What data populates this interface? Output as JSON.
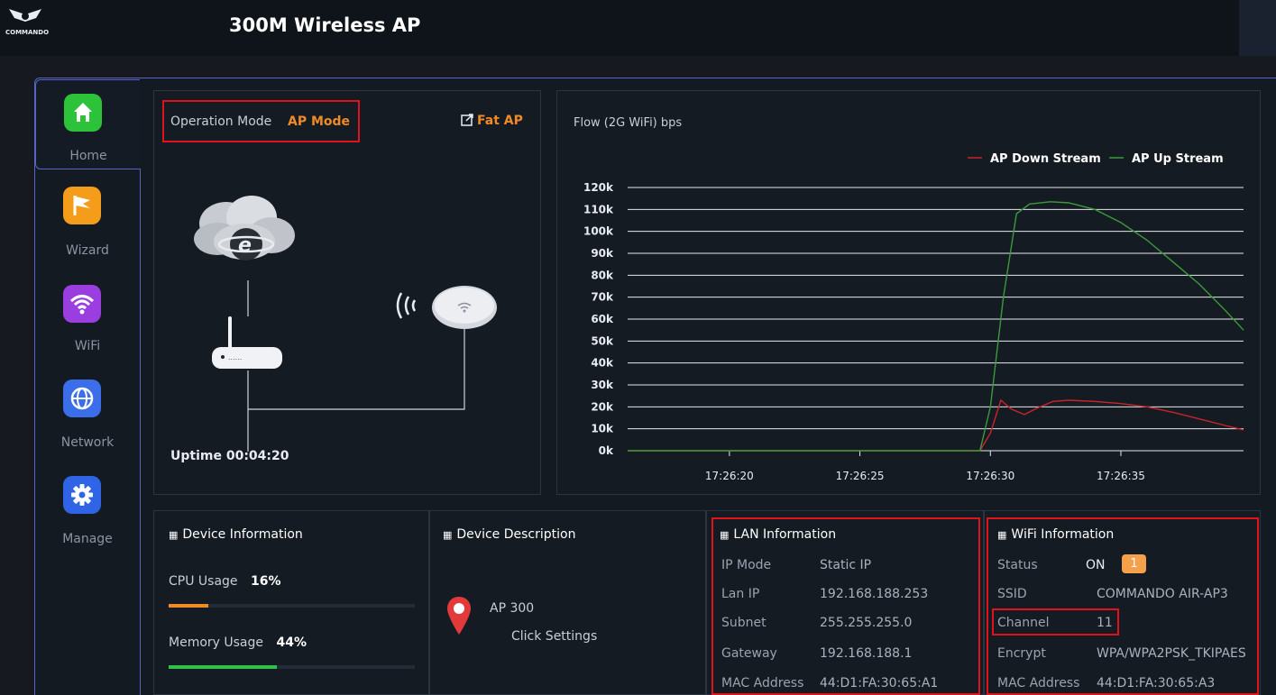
{
  "header": {
    "title": "300M Wireless AP",
    "brand": "COMMANDO"
  },
  "sidebar": {
    "items": [
      {
        "label": "Home",
        "icon": "home-icon",
        "color": "#2cc23a",
        "active": true
      },
      {
        "label": "Wizard",
        "icon": "flag-icon",
        "color": "#f59c1a",
        "active": false
      },
      {
        "label": "WiFi",
        "icon": "wifi-icon",
        "color": "#9a3ee0",
        "active": false
      },
      {
        "label": "Network",
        "icon": "globe-icon",
        "color": "#3b6ee8",
        "active": false
      },
      {
        "label": "Manage",
        "icon": "gear-icon",
        "color": "#2f64e6",
        "active": false
      }
    ]
  },
  "status": {
    "operation_mode_label": "Operation Mode",
    "operation_mode_value": "AP Mode",
    "fat_ap_label": "Fat AP",
    "uptime": "Uptime 00:04:20"
  },
  "chart_data": {
    "type": "line",
    "title": "Flow (2G WiFi) bps",
    "legend_position": "top-right",
    "y_ticks": [
      "0k",
      "10k",
      "20k",
      "30k",
      "40k",
      "50k",
      "60k",
      "70k",
      "80k",
      "90k",
      "100k",
      "110k",
      "120k"
    ],
    "x_ticks": [
      "17:26:20",
      "17:26:25",
      "17:26:30",
      "17:26:35"
    ],
    "ylim": [
      0,
      120000
    ],
    "xlim": [
      -3.9,
      19.7
    ],
    "x_tick_values": [
      0,
      5,
      10,
      15
    ],
    "grid": true,
    "series": [
      {
        "name": "AP Down Stream",
        "color": "#c9242b",
        "points": [
          [
            -3.9,
            0
          ],
          [
            9.6,
            0
          ],
          [
            10.0,
            8000
          ],
          [
            10.4,
            23000
          ],
          [
            10.8,
            19000
          ],
          [
            11.3,
            16500
          ],
          [
            11.8,
            19500
          ],
          [
            12.4,
            22500
          ],
          [
            13.0,
            23000
          ],
          [
            14.0,
            22500
          ],
          [
            15.0,
            21500
          ],
          [
            16.0,
            20000
          ],
          [
            17.0,
            17500
          ],
          [
            18.0,
            14500
          ],
          [
            19.0,
            11500
          ],
          [
            19.7,
            9500
          ]
        ]
      },
      {
        "name": "AP Up Stream",
        "color": "#3c9a3c",
        "points": [
          [
            -3.9,
            0
          ],
          [
            9.6,
            0
          ],
          [
            10.0,
            20000
          ],
          [
            10.5,
            70000
          ],
          [
            11.0,
            108000
          ],
          [
            11.5,
            112500
          ],
          [
            12.3,
            113500
          ],
          [
            13.0,
            113000
          ],
          [
            14.0,
            110000
          ],
          [
            15.0,
            104000
          ],
          [
            16.0,
            96000
          ],
          [
            17.0,
            86000
          ],
          [
            18.0,
            76000
          ],
          [
            19.0,
            64000
          ],
          [
            19.7,
            55000
          ]
        ]
      }
    ]
  },
  "device_info": {
    "title": "Device Information",
    "cpu_label": "CPU Usage",
    "cpu_value": "16%",
    "cpu_fraction": 0.16,
    "cpu_color": "#f08a24",
    "mem_label": "Memory Usage",
    "mem_value": "44%",
    "mem_fraction": 0.44,
    "mem_color": "#2ec24a"
  },
  "device_desc": {
    "title": "Device Description",
    "name": "AP 300",
    "action": "Click Settings"
  },
  "lan": {
    "title": "LAN Information",
    "rows": [
      {
        "label": "IP Mode",
        "value": "Static IP"
      },
      {
        "label": "Lan IP",
        "value": "192.168.188.253"
      },
      {
        "label": "Subnet",
        "value": "255.255.255.0"
      },
      {
        "label": "Gateway",
        "value": "192.168.188.1"
      },
      {
        "label": "MAC Address",
        "value": "44:D1:FA:30:65:A1"
      }
    ]
  },
  "wifi": {
    "title": "WiFi Information",
    "status_label": "Status",
    "status_value": "ON",
    "status_badge": "1",
    "ssid_label": "SSID",
    "ssid_value": "COMMANDO AIR-AP3",
    "channel_label": "Channel",
    "channel_value": "11",
    "encrypt_label": "Encrypt",
    "encrypt_value": "WPA/WPA2PSK_TKIPAES",
    "mac_label": "MAC Address",
    "mac_value": "44:D1:FA:30:65:A3"
  }
}
